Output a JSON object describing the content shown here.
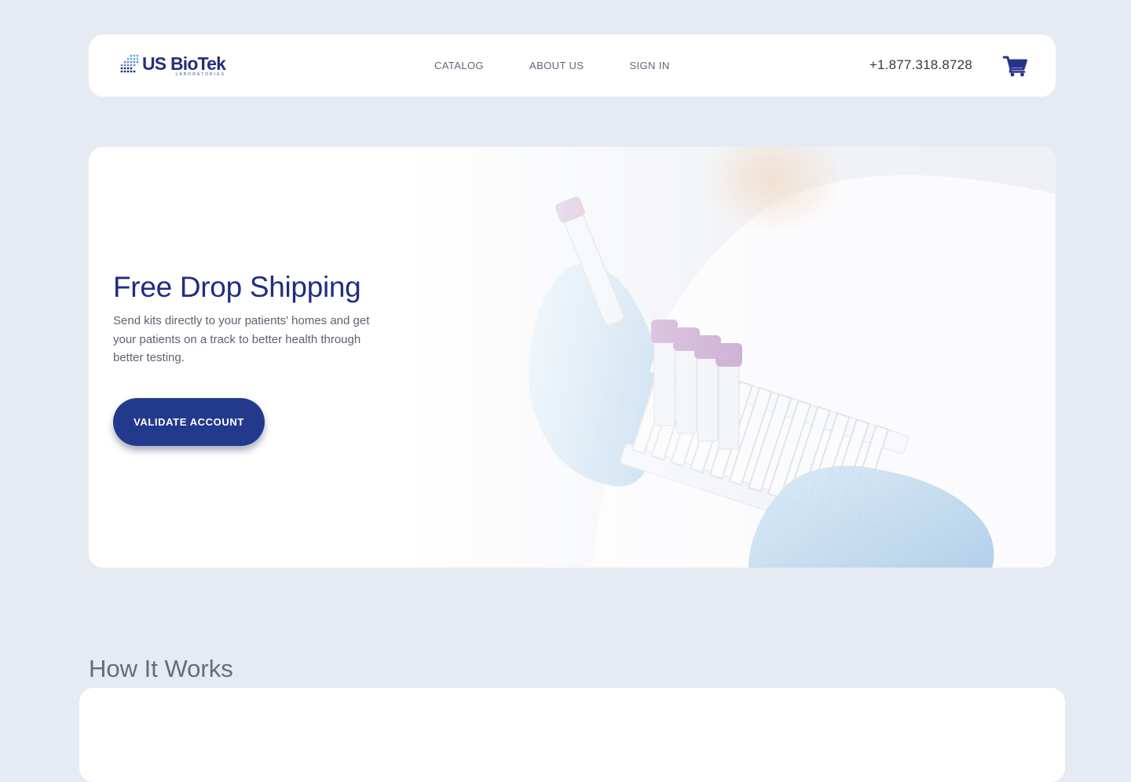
{
  "header": {
    "logo": {
      "name": "US BioTek",
      "subtitle": "LABORATORIES"
    },
    "nav": [
      {
        "label": "CATALOG"
      },
      {
        "label": "ABOUT US"
      },
      {
        "label": "SIGN IN"
      }
    ],
    "phone": "+1.877.318.8728",
    "cart_icon": "shopping-cart-icon"
  },
  "hero": {
    "title": "Free Drop Shipping",
    "description": "Send kits directly to your patients' homes and get your patients on a track to better health through better testing.",
    "button_label": "VALIDATE ACCOUNT"
  },
  "section": {
    "title": "How It Works"
  },
  "colors": {
    "page_background": "#e6eaf2",
    "brand_navy": "#1f2d84",
    "button": "#233a8c",
    "nav_text": "#5f6778"
  }
}
